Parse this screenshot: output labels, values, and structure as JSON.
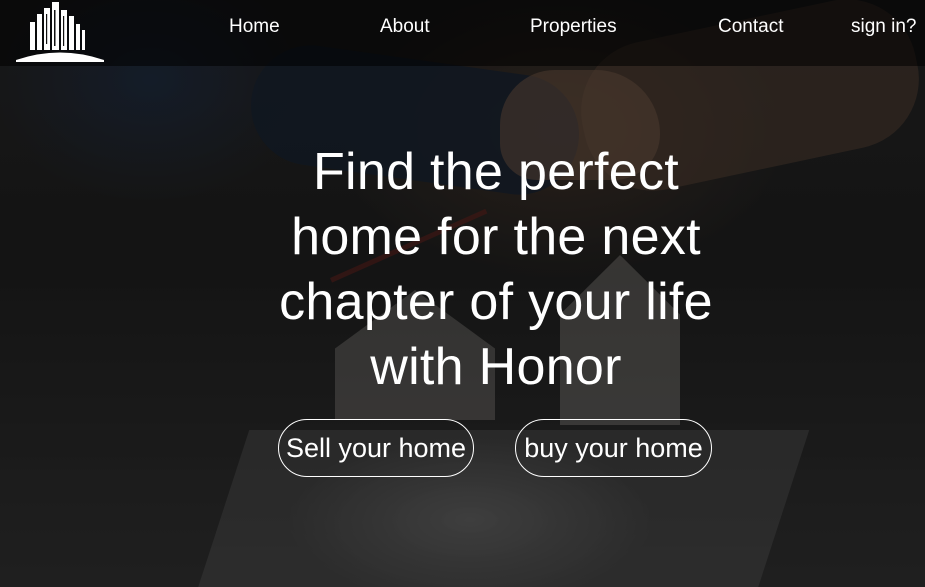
{
  "brand": {
    "logo_icon": "city-buildings-icon"
  },
  "nav": {
    "items": [
      {
        "label": "Home"
      },
      {
        "label": "About"
      },
      {
        "label": "Properties"
      },
      {
        "label": "Contact"
      }
    ],
    "signin_label": "sign in?"
  },
  "hero": {
    "title_lines": [
      "Find the perfect",
      "home for the next",
      "chapter of your life",
      "with Honor"
    ],
    "sell_button": "Sell your home",
    "buy_button": "buy your home",
    "background_image": "handshake-over-house-models"
  },
  "colors": {
    "text": "#ffffff",
    "navbar_bg": "#000000",
    "button_border": "#ffffff"
  }
}
